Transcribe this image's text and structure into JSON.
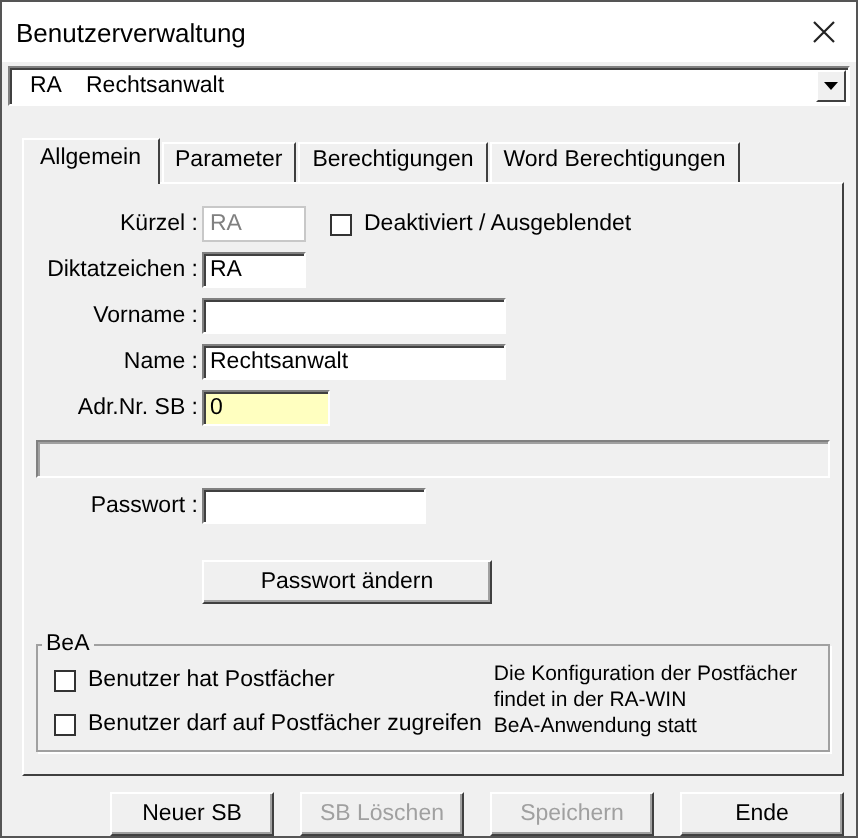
{
  "window": {
    "title": "Benutzerverwaltung"
  },
  "user_select": {
    "code": "RA",
    "name": "Rechtsanwalt"
  },
  "tabs": [
    {
      "label": "Allgemein",
      "selected": true
    },
    {
      "label": "Parameter",
      "selected": false
    },
    {
      "label": "Berechtigungen",
      "selected": false
    },
    {
      "label": "Word Berechtigungen",
      "selected": false
    }
  ],
  "fields": [
    {
      "label": "Kürzel :",
      "value": "RA",
      "kind": "short",
      "disabled": true,
      "highlighted": false
    },
    {
      "label": "Diktatzeichen :",
      "value": "RA",
      "kind": "short",
      "disabled": false,
      "highlighted": false
    },
    {
      "label": "Vorname :",
      "kind": "long",
      "highlighted": false
    },
    {
      "label": "Name :",
      "value": "Rechtsanwalt",
      "kind": "long",
      "disabled": false,
      "highlighted": false
    },
    {
      "label": "Adr.Nr. SB :",
      "value": "0",
      "kind": "medium",
      "disabled": false,
      "highlighted": true
    }
  ],
  "deactivated": {
    "label": "Deaktiviert / Ausgeblendet",
    "checked": false
  },
  "password": {
    "label": "Passwort :"
  },
  "change_password_button": {
    "label": "Passwort ändern"
  },
  "bea": {
    "title": "BeA",
    "options": [
      {
        "label": "Benutzer hat Postfächer",
        "checked": false
      },
      {
        "label": "Benutzer darf auf Postfächer zugreifen",
        "checked": false
      }
    ],
    "note": "Die Konfiguration der Postfächer\nfindet in der RA-WIN\nBeA-Anwendung statt"
  },
  "buttons": [
    {
      "label": "Neuer SB",
      "disabled": false
    },
    {
      "label": "SB Löschen",
      "disabled": true
    },
    {
      "label": "Speichern",
      "disabled": true
    },
    {
      "label": "Ende",
      "disabled": false
    }
  ]
}
